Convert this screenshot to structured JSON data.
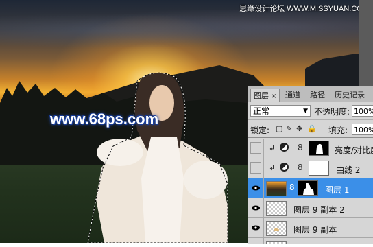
{
  "watermark_top": "思缘设计论坛 WWW.MISSYUAN.COM",
  "watermark_site": "www.68ps.com",
  "panel": {
    "tabs": [
      {
        "label": "图层",
        "close": "×",
        "active": true
      },
      {
        "label": "通道",
        "active": false
      },
      {
        "label": "路径",
        "active": false
      },
      {
        "label": "历史记录",
        "active": false
      }
    ],
    "blend_mode": "正常",
    "opacity_label": "不透明度:",
    "opacity_value": "100%",
    "lock_label": "锁定:",
    "fill_label": "填充:",
    "fill_value": "100%",
    "layers": [
      {
        "name": "亮度/对比度",
        "visible": false,
        "type": "adjustment"
      },
      {
        "name": "曲线 2",
        "visible": false,
        "type": "adjustment"
      },
      {
        "name": "图层 1",
        "visible": true,
        "selected": true,
        "type": "masked"
      },
      {
        "name": "图层 9 副本 2",
        "visible": true,
        "type": "pixel"
      },
      {
        "name": "图层 9 副本",
        "visible": true,
        "type": "pixel"
      }
    ]
  },
  "colors": {
    "selection": "#3b8fe8",
    "panel_bg": "#d6d6d6",
    "watermark_glow": "#2a5ac8"
  }
}
